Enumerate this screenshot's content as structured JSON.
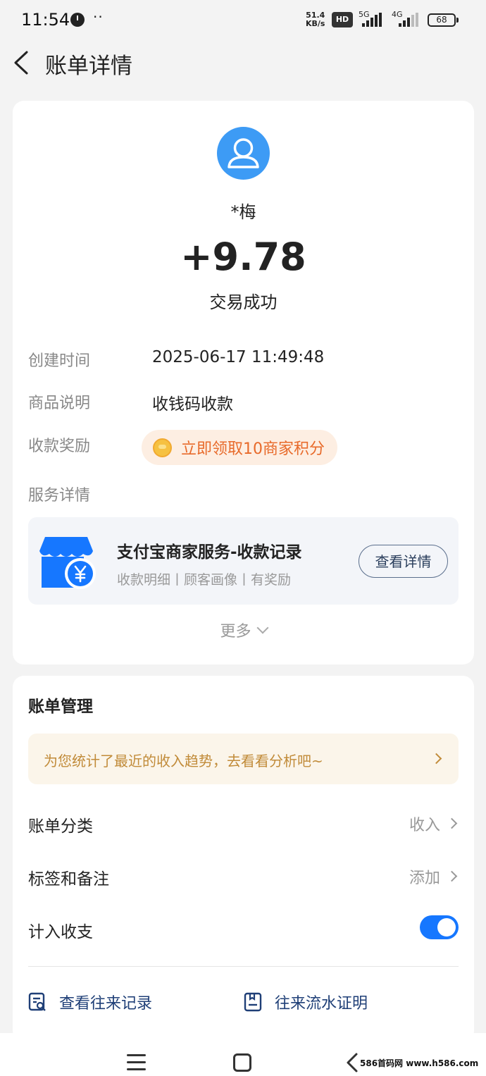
{
  "status_bar": {
    "time": "11:54",
    "more": "··",
    "speed_value": "51.4",
    "speed_unit": "KB/s",
    "hd_badge": "HD",
    "net1": "5G",
    "net2": "4G",
    "battery": "68"
  },
  "header": {
    "title": "账单详情"
  },
  "transaction": {
    "payer_name": "*梅",
    "amount": "+9.78",
    "status": "交易成功"
  },
  "details": {
    "created_label": "创建时间",
    "created_value": "2025-06-17 11:49:48",
    "product_label": "商品说明",
    "product_value": "收钱码收款",
    "reward_label": "收款奖励",
    "reward_text": "立即领取10商家积分",
    "service_label": "服务详情"
  },
  "service": {
    "title": "支付宝商家服务-收款记录",
    "subtitle": "收款明细丨顾客画像丨有奖励",
    "button": "查看详情"
  },
  "more_label": "更多",
  "management": {
    "title": "账单管理",
    "banner_text": "为您统计了最近的收入趋势，去看看分析吧~",
    "category_label": "账单分类",
    "category_value": "收入",
    "tags_label": "标签和备注",
    "tags_value": "添加",
    "include_label": "计入收支",
    "include_on": true,
    "link1": "查看往来记录",
    "link2": "往来流水证明"
  },
  "watermark": "586首码网 www.h586.com",
  "colors": {
    "accent": "#1677ff",
    "avatar": "#3d9bf5",
    "reward_text": "#e86a2a",
    "banner_text": "#c18b39",
    "link_text": "#1f3f77"
  }
}
